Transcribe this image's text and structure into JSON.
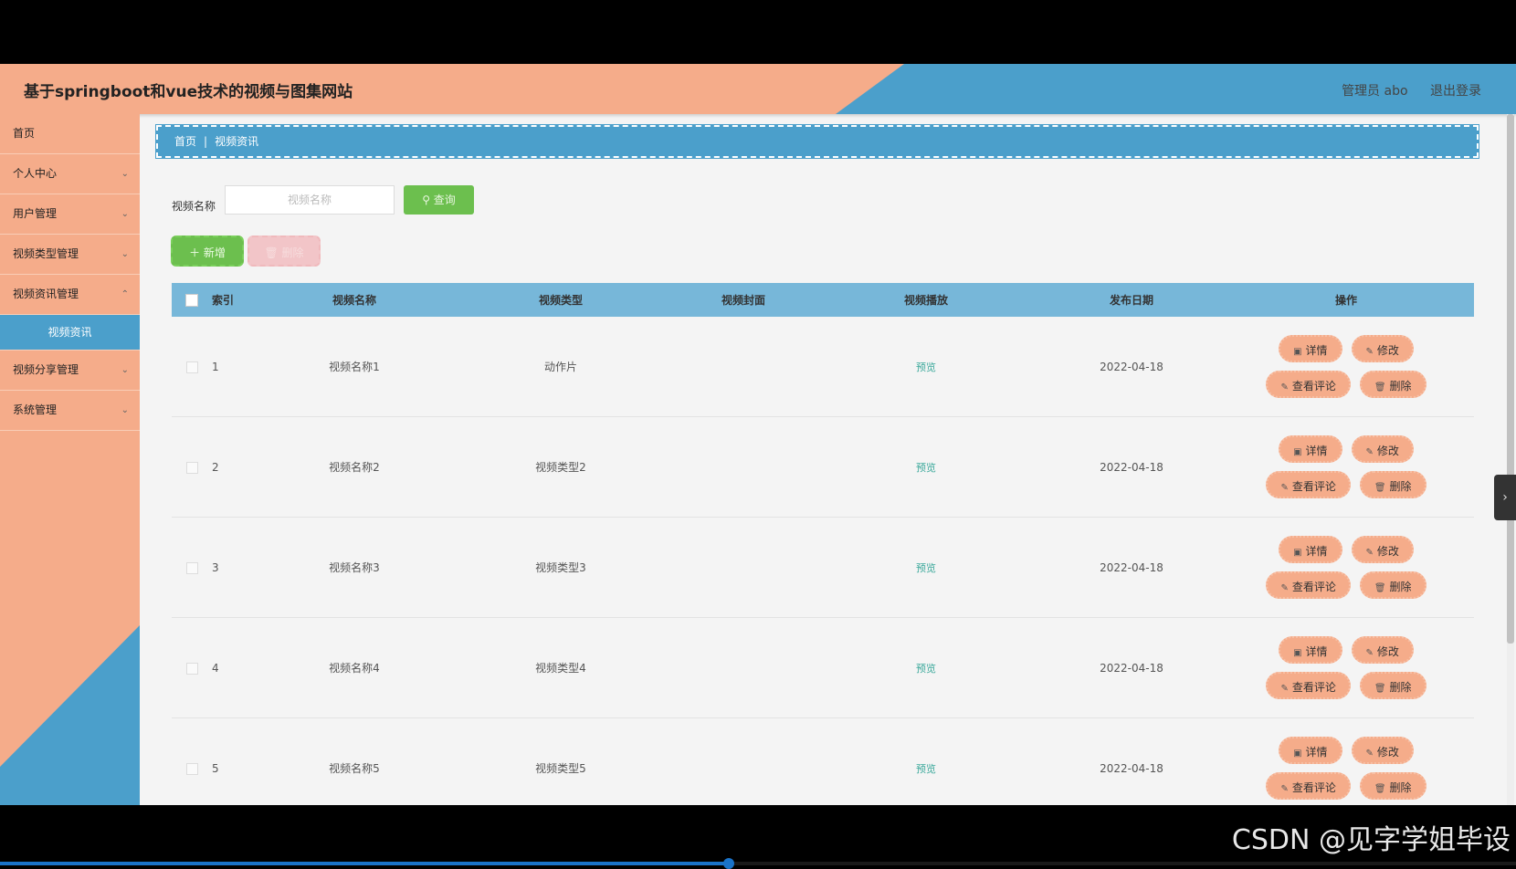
{
  "header": {
    "title": "基于springboot和vue技术的视频与图集网站",
    "user": "管理员 abo",
    "logout": "退出登录"
  },
  "sidebar": {
    "items": [
      {
        "label": "首页"
      },
      {
        "label": "个人中心"
      },
      {
        "label": "用户管理"
      },
      {
        "label": "视频类型管理"
      },
      {
        "label": "视频资讯管理"
      },
      {
        "label": "视频资讯"
      },
      {
        "label": "视频分享管理"
      },
      {
        "label": "系统管理"
      }
    ]
  },
  "breadcrumb": {
    "home": "首页",
    "sep": "|",
    "current": "视频资讯"
  },
  "search": {
    "label": "视频名称",
    "placeholder": "视频名称",
    "button": "查询"
  },
  "actions": {
    "add": "新增",
    "delete": "删除"
  },
  "table": {
    "headers": [
      "索引",
      "视频名称",
      "视频类型",
      "视频封面",
      "视频播放",
      "发布日期",
      "操作"
    ],
    "rows": [
      {
        "idx": "1",
        "name": "视频名称1",
        "type": "动作片",
        "play": "预览",
        "date": "2022-04-18"
      },
      {
        "idx": "2",
        "name": "视频名称2",
        "type": "视频类型2",
        "play": "预览",
        "date": "2022-04-18"
      },
      {
        "idx": "3",
        "name": "视频名称3",
        "type": "视频类型3",
        "play": "预览",
        "date": "2022-04-18"
      },
      {
        "idx": "4",
        "name": "视频名称4",
        "type": "视频类型4",
        "play": "预览",
        "date": "2022-04-18"
      },
      {
        "idx": "5",
        "name": "视频名称5",
        "type": "视频类型5",
        "play": "预览",
        "date": "2022-04-18"
      }
    ],
    "ops": {
      "detail": "详情",
      "edit": "修改",
      "comments": "查看评论",
      "delete": "删除"
    }
  },
  "watermark": "CSDN @见字学姐毕设",
  "colors": {
    "peach": "#f5ac8a",
    "blue": "#4b9fcb",
    "green": "#6cbf4e"
  }
}
